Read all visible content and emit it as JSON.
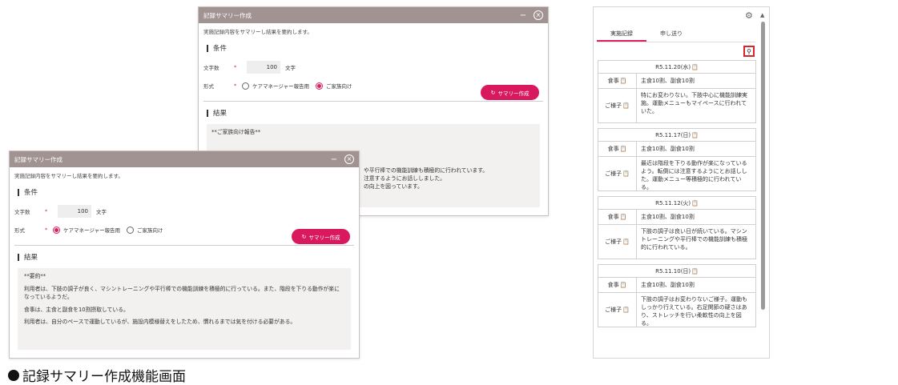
{
  "dialog": {
    "title": "記録サマリー作成",
    "minimize": "−",
    "close": "×",
    "description": "実施記録内容をサマリーし結果を要約します。",
    "condition_heading": "条件",
    "char_count_label": "文字数",
    "required_mark": "*",
    "char_count_value": "100",
    "char_unit": "文字",
    "format_label": "形式",
    "format_options": [
      "ケアマネージャー報告用",
      "ご家族向け"
    ],
    "summary_button": "サマリー作成",
    "summary_icon": "refresh-icon",
    "result_heading": "結果"
  },
  "back_dialog": {
    "selected_format": "ご家族向け",
    "result_lines": [
      "**ご家族向け報告**",
      "",
      "や平行棒での機能訓練も積極的に行われています。",
      "注意するようにお話ししました。",
      "の向上を図っています。"
    ]
  },
  "front_dialog": {
    "selected_format": "ケアマネージャー報告用",
    "result_lines": [
      "**要約**",
      "利用者は、下肢の調子が良く、マシントレーニングや平行棒での機能訓練を積極的に行っている。また、階段を下りる動作が楽になっているようだ。",
      "食事は、主食と副食を10割摂取している。",
      "利用者は、自分のペースで運動しているが、施設内模様替えをしたため、慣れるまでは気を付ける必要がある。"
    ]
  },
  "panel": {
    "tabs": [
      "実施記録",
      "申し送り"
    ],
    "active_tab": 0,
    "gear_icon": "gear-icon",
    "pin_icon": "pin-icon",
    "records": [
      {
        "date": "R5.11.20(水)",
        "meal_label": "食事",
        "meal": "主食10割、副食10割",
        "cond_label": "ご様子",
        "cond": "特にお変わりない。下肢中心に機能訓練実施。運動メニューもマイペースに行われていた。"
      },
      {
        "date": "R5.11.17(日)",
        "meal_label": "食事",
        "meal": "主食10割、副食10割",
        "cond_label": "ご様子",
        "cond": "最近は階段を下りる動作が楽になっているよう。転倒には注意するようにとお話しした。運動メニュー等積極的に行われている。"
      },
      {
        "date": "R5.11.12(火)",
        "meal_label": "食事",
        "meal": "主食10割、副食10割",
        "cond_label": "ご様子",
        "cond": "下肢の調子は良い日が続いている。マシントレーニングや平行棒での機能訓練も積極的に行われている。"
      },
      {
        "date": "R5.11.10(日)",
        "meal_label": "食事",
        "meal": "主食10割、副食10割",
        "cond_label": "ご様子",
        "cond": "下肢の調子はお変わりないご様子。運動もしっかり行えている。右足関節の硬さはあり、ストレッチを行い柔軟性の向上を図る。"
      }
    ]
  },
  "caption": "記録サマリー作成機能画面"
}
